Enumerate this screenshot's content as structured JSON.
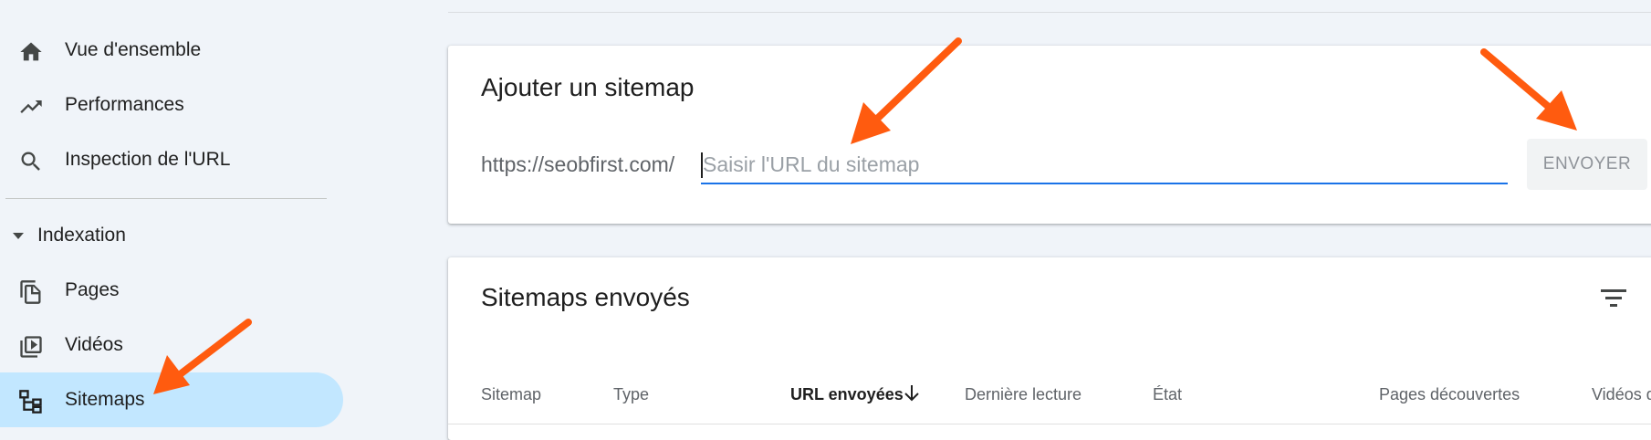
{
  "sidebar": {
    "items": [
      {
        "label": "Vue d'ensemble",
        "icon": "home-icon"
      },
      {
        "label": "Performances",
        "icon": "trending-up-icon"
      },
      {
        "label": "Inspection de l'URL",
        "icon": "search-icon"
      }
    ],
    "section": {
      "label": "Indexation",
      "icon": "caret-down-icon"
    },
    "section_items": [
      {
        "label": "Pages",
        "icon": "pages-icon"
      },
      {
        "label": "Vidéos",
        "icon": "video-library-icon"
      },
      {
        "label": "Sitemaps",
        "icon": "sitemap-icon",
        "active": true
      }
    ]
  },
  "add_sitemap": {
    "title": "Ajouter un sitemap",
    "url_prefix": "https://seobfirst.com/",
    "input_value": "",
    "input_placeholder": "Saisir l'URL du sitemap",
    "submit_label": "ENVOYER"
  },
  "submitted": {
    "title": "Sitemaps envoyés",
    "filter_icon": "filter-list-icon",
    "columns": [
      "Sitemap",
      "Type",
      "URL envoyées",
      "Dernière lecture",
      "État",
      "Pages découvertes",
      "Vidéos d"
    ],
    "sorted_column": "URL envoyées",
    "sort_icon": "arrow-down-icon"
  },
  "colors": {
    "accent": "#1a73e8",
    "active_nav": "#c2e7ff",
    "annotation_arrow": "#ff5b0f",
    "background": "#f0f4f9"
  }
}
